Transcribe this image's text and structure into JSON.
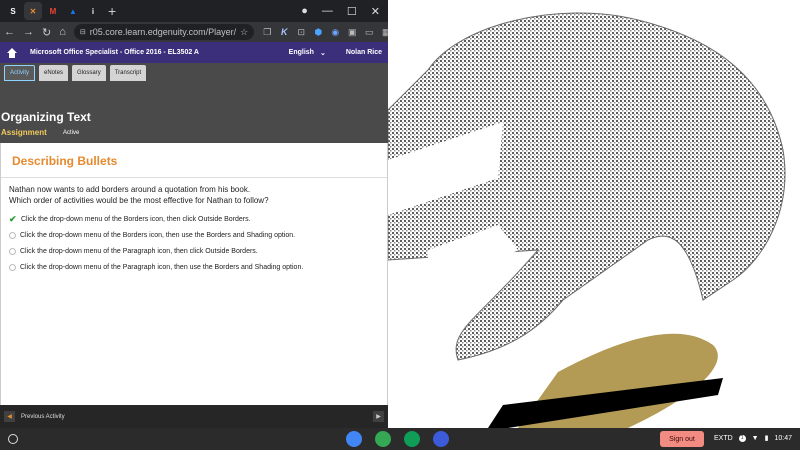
{
  "browser": {
    "tabs": [
      {
        "icon": "s-icon",
        "glyph": "S",
        "color": "#ffffff"
      },
      {
        "icon": "edgenuity-icon",
        "glyph": "✕",
        "color": "#e58a2e"
      },
      {
        "icon": "gmail-icon",
        "glyph": "M",
        "color": "#ea4335"
      },
      {
        "icon": "classroom-icon",
        "glyph": "▲",
        "color": "#1a73e8"
      },
      {
        "icon": "info-icon",
        "glyph": "i",
        "color": "#e8eaed"
      }
    ],
    "new_tab": "+",
    "url": "r05.core.learn.edgenuity.com/Player/",
    "extension_letter": "K"
  },
  "appbar": {
    "course": "Microsoft Office Specialist - Office 2016 - EL3502 A",
    "language": "English",
    "user": "Nolan Rice"
  },
  "subnav": {
    "tabs": [
      "Activity",
      "eNotes",
      "Glossary",
      "Transcript"
    ]
  },
  "lesson": {
    "title": "Organizing Text",
    "type": "Assignment",
    "status": "Active"
  },
  "activity": {
    "title": "Describing Bullets",
    "question_line1": "Nathan now wants to add borders around a quotation from his book.",
    "question_line2": "Which order of activities would be the most effective for Nathan to follow?",
    "options": [
      "Click the drop-down menu of the Borders icon, then click Outside Borders.",
      "Click the drop-down menu of the Borders icon, then use the Borders and Shading option.",
      "Click the drop-down menu of the Paragraph icon, then click Outside Borders.",
      "Click the drop-down menu of the Paragraph icon, then use the Borders and Shading option."
    ],
    "selected_index": 0
  },
  "footer": {
    "previous": "Previous Activity"
  },
  "shelf": {
    "sign_out": "Sign out",
    "keyboard": "EXTD",
    "notification_count": "1",
    "time": "10:47",
    "apps": [
      {
        "name": "chrome-icon",
        "color": "#4285f4"
      },
      {
        "name": "play-store-icon",
        "color": "#34a853"
      },
      {
        "name": "classroom-app-icon",
        "color": "#0f9d58"
      },
      {
        "name": "k-app-icon",
        "color": "#3b5bdb"
      }
    ]
  },
  "drawing_colors": {
    "stipple": "#6a6a6a",
    "gold": "#b39b55",
    "black": "#000000"
  }
}
